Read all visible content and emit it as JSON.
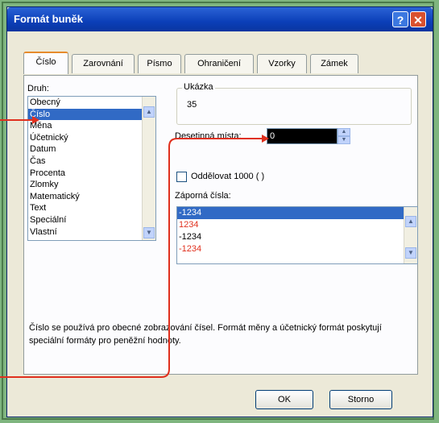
{
  "dialog": {
    "title": "Formát buněk",
    "help_glyph": "?",
    "close_glyph": "✕"
  },
  "tabs": [
    {
      "label": "Číslo",
      "active": true
    },
    {
      "label": "Zarovnání",
      "active": false
    },
    {
      "label": "Písmo",
      "active": false
    },
    {
      "label": "Ohraničení",
      "active": false
    },
    {
      "label": "Vzorky",
      "active": false
    },
    {
      "label": "Zámek",
      "active": false
    }
  ],
  "category": {
    "label": "Druh:",
    "items": [
      "Obecný",
      "Číslo",
      "Měna",
      "Účetnický",
      "Datum",
      "Čas",
      "Procenta",
      "Zlomky",
      "Matematický",
      "Text",
      "Speciální",
      "Vlastní"
    ],
    "selected": "Číslo"
  },
  "sample": {
    "label": "Ukázka",
    "value": "35"
  },
  "decimal": {
    "label": "Desetinná místa:",
    "value": "0"
  },
  "thousands": {
    "label": "Oddělovat 1000 ( )",
    "checked": false
  },
  "negative": {
    "label": "Záporná čísla:",
    "items": [
      {
        "text": "-1234",
        "color": "#ffffff",
        "selected": true
      },
      {
        "text": "1234",
        "color": "#e0301e",
        "selected": false
      },
      {
        "text": "-1234",
        "color": "#000000",
        "selected": false
      },
      {
        "text": "-1234",
        "color": "#e0301e",
        "selected": false
      }
    ]
  },
  "description": "Číslo se používá pro obecné zobrazování čísel. Formát měny a účetnický formát poskytují speciální formáty pro peněžní hodnoty.",
  "buttons": {
    "ok": "OK",
    "cancel": "Storno"
  },
  "colors": {
    "accent": "#316ac5",
    "callout": "#e0301e",
    "background": "#7fb57f"
  }
}
